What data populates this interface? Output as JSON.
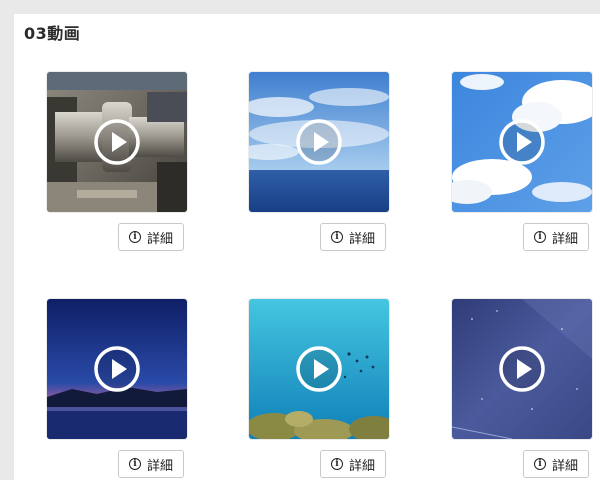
{
  "section": {
    "title": "03動画"
  },
  "videos": [
    {
      "id": "v1",
      "thumbnail": "machine-lathe",
      "detail_label": "詳細"
    },
    {
      "id": "v2",
      "thumbnail": "sky-ocean",
      "detail_label": "詳細"
    },
    {
      "id": "v3",
      "thumbnail": "blue-sky-clouds",
      "detail_label": "詳細"
    },
    {
      "id": "v4",
      "thumbnail": "dusk-lake",
      "detail_label": "詳細"
    },
    {
      "id": "v5",
      "thumbnail": "underwater-reef",
      "detail_label": "詳細"
    },
    {
      "id": "v6",
      "thumbnail": "starry-night-sky",
      "detail_label": "詳細"
    }
  ],
  "colors": {
    "background": "#e9e9e9",
    "panel": "#ffffff",
    "button_border": "#c9c9c9"
  }
}
